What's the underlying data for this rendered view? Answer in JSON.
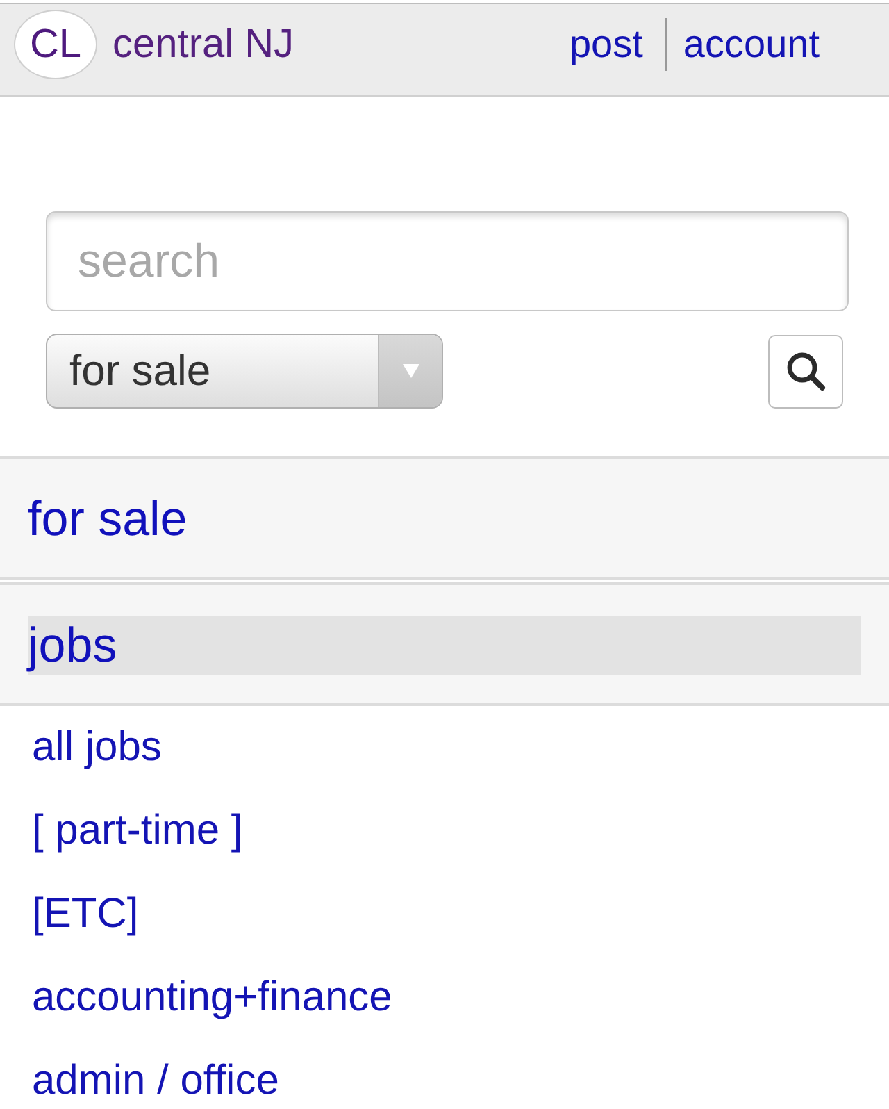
{
  "header": {
    "logo": "CL",
    "location": "central NJ",
    "links": [
      {
        "label": "post"
      },
      {
        "label": "account"
      }
    ]
  },
  "search": {
    "placeholder": "search",
    "category": "for sale"
  },
  "sections": [
    {
      "title": "for sale",
      "selected": false
    },
    {
      "title": "jobs",
      "selected": true,
      "items": [
        "all jobs",
        "[ part-time ]",
        "[ETC]",
        "accounting+finance",
        "admin / office"
      ]
    }
  ]
}
